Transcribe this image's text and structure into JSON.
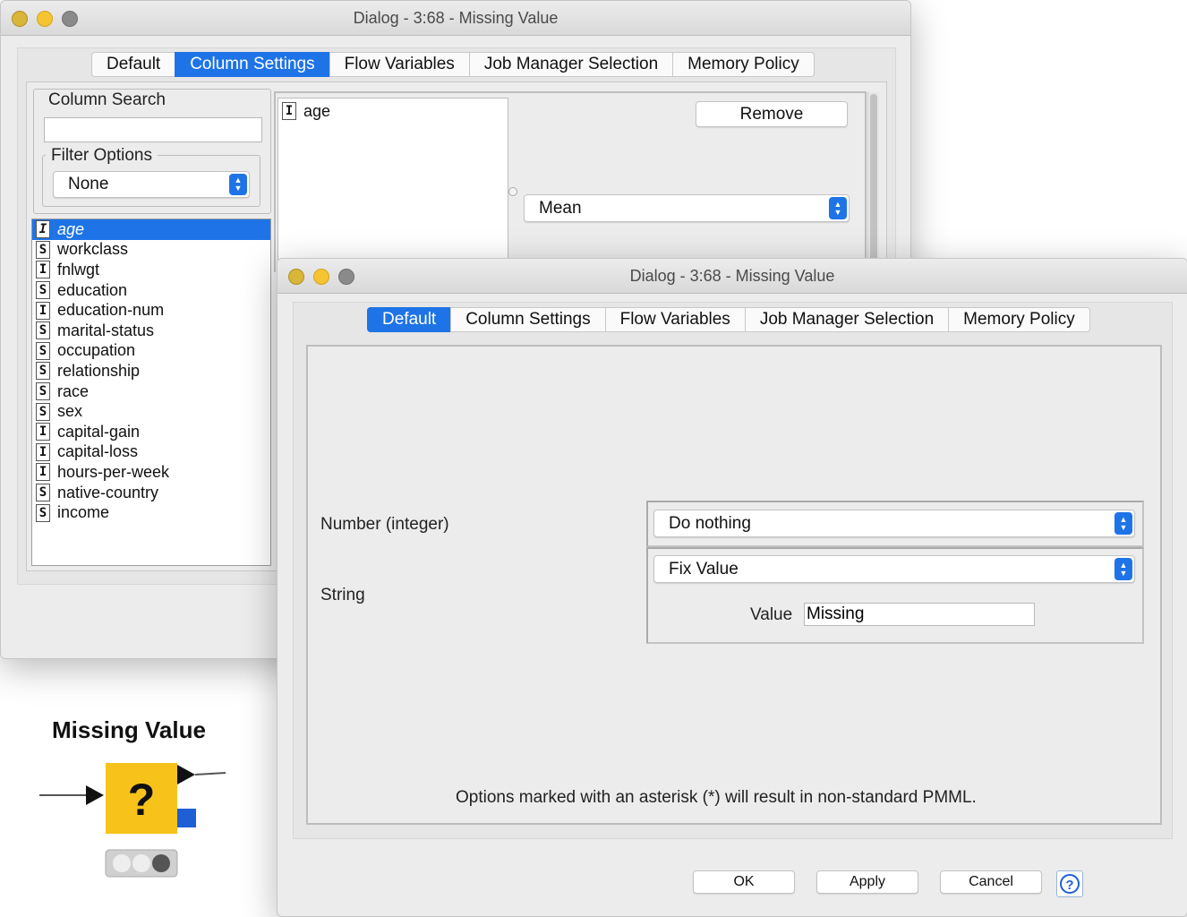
{
  "back_dialog": {
    "title": "Dialog - 3:68 - Missing Value",
    "tabs": [
      "Default",
      "Column Settings",
      "Flow Variables",
      "Job Manager Selection",
      "Memory Policy"
    ],
    "active_tab": "Column Settings",
    "column_search": {
      "label": "Column Search",
      "value": ""
    },
    "filter_options": {
      "label": "Filter Options",
      "selected": "None"
    },
    "columns": [
      {
        "type": "I",
        "name": "age",
        "selected": true
      },
      {
        "type": "S",
        "name": "workclass"
      },
      {
        "type": "I",
        "name": "fnlwgt"
      },
      {
        "type": "S",
        "name": "education"
      },
      {
        "type": "I",
        "name": "education-num"
      },
      {
        "type": "S",
        "name": "marital-status"
      },
      {
        "type": "S",
        "name": "occupation"
      },
      {
        "type": "S",
        "name": "relationship"
      },
      {
        "type": "S",
        "name": "race"
      },
      {
        "type": "S",
        "name": "sex"
      },
      {
        "type": "I",
        "name": "capital-gain"
      },
      {
        "type": "I",
        "name": "capital-loss"
      },
      {
        "type": "I",
        "name": "hours-per-week"
      },
      {
        "type": "S",
        "name": "native-country"
      },
      {
        "type": "S",
        "name": "income"
      }
    ],
    "config": {
      "column": {
        "type": "I",
        "name": "age"
      },
      "remove_label": "Remove",
      "method": "Mean"
    }
  },
  "front_dialog": {
    "title": "Dialog - 3:68 - Missing Value",
    "tabs": [
      "Default",
      "Column Settings",
      "Flow Variables",
      "Job Manager Selection",
      "Memory Policy"
    ],
    "active_tab": "Default",
    "number_integer": {
      "label": "Number (integer)",
      "selected": "Do nothing"
    },
    "string": {
      "label": "String",
      "selected": "Fix Value",
      "value_label": "Value",
      "value": "Missing"
    },
    "footnote": "Options marked with an asterisk (*) will result in non-standard PMML.",
    "buttons": {
      "ok": "OK",
      "apply": "Apply",
      "cancel": "Cancel"
    },
    "help_icon": "help-icon"
  },
  "node": {
    "name": "Missing Value",
    "symbol": "?",
    "colors": {
      "body": "#f7c31a",
      "port": "#1e5fd6",
      "status_off": "#e6e6e6",
      "status_on": "#555555"
    }
  },
  "colors": {
    "accent": "#1e74e6",
    "window_bg": "#ececec"
  }
}
